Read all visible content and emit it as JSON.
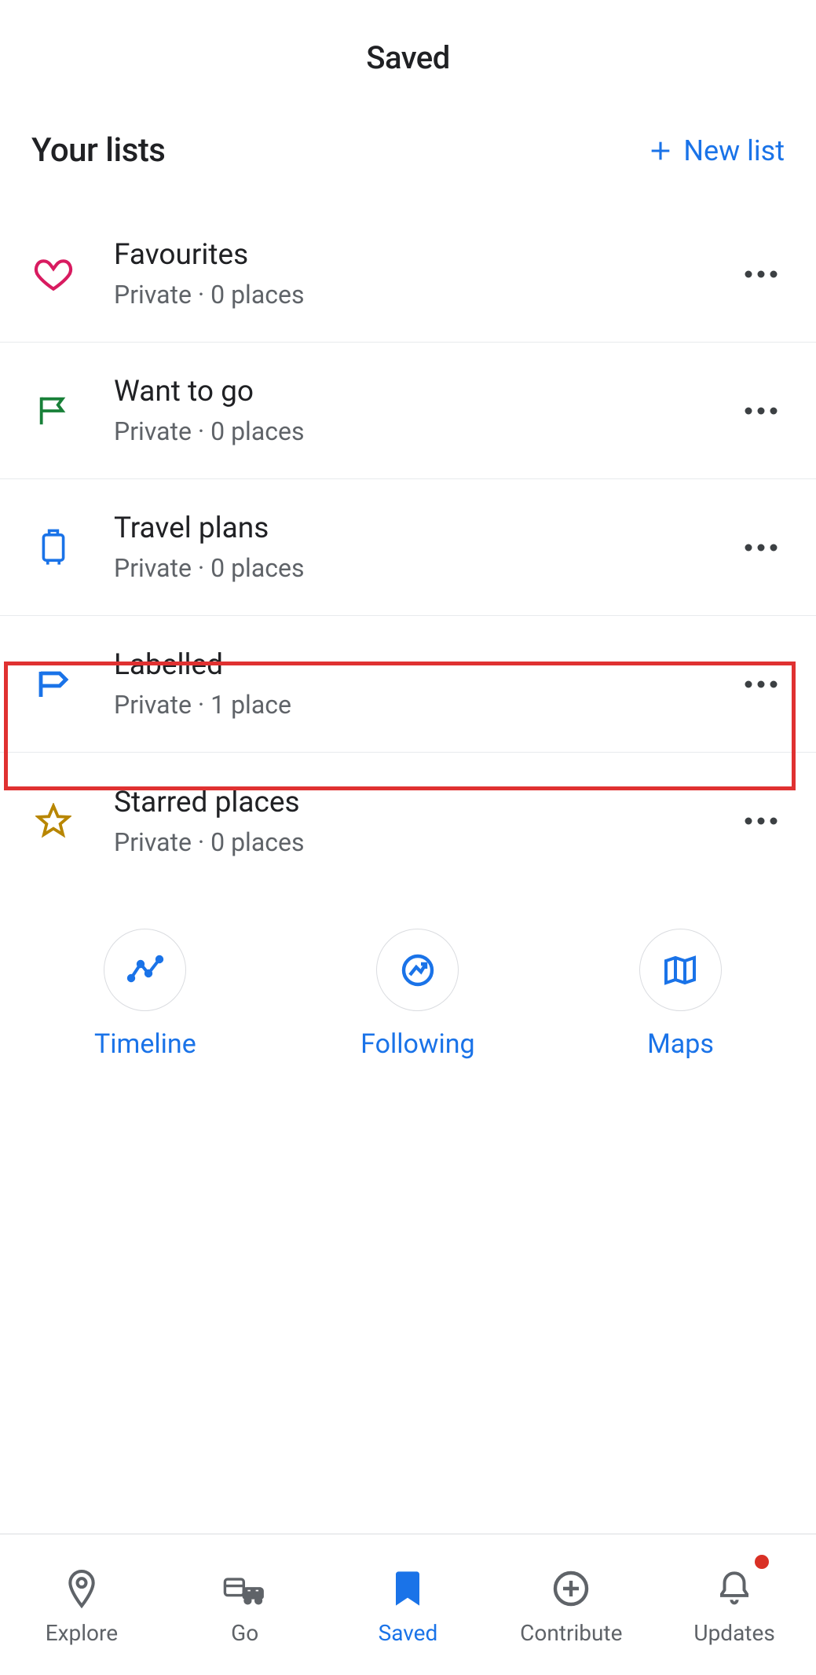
{
  "header": {
    "title": "Saved"
  },
  "subheader": {
    "title": "Your lists",
    "new_list": "New list"
  },
  "lists": [
    {
      "title": "Favourites",
      "sub": "Private · 0 places"
    },
    {
      "title": "Want to go",
      "sub": "Private · 0 places"
    },
    {
      "title": "Travel plans",
      "sub": "Private · 0 places"
    },
    {
      "title": "Labelled",
      "sub": "Private · 1 place"
    },
    {
      "title": "Starred places",
      "sub": "Private · 0 places"
    }
  ],
  "actions": {
    "timeline": "Timeline",
    "following": "Following",
    "maps": "Maps"
  },
  "nav": {
    "explore": "Explore",
    "go": "Go",
    "saved": "Saved",
    "contribute": "Contribute",
    "updates": "Updates"
  }
}
